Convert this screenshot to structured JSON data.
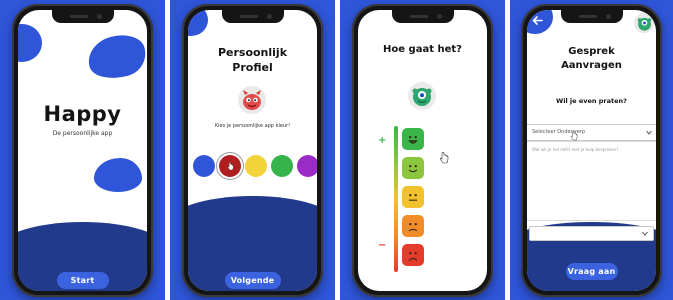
{
  "screens": {
    "welcome": {
      "app_name": "Happy",
      "tagline": "De persoonlijke app",
      "start_button": "Start"
    },
    "profile": {
      "title_line1": "Persoonlijk",
      "title_line2": "Profiel",
      "instruction": "Kies je persoonlijke app kleur!",
      "color_options": [
        "#2f55d9",
        "#b01f1f",
        "#f2d33a",
        "#36b34a",
        "#9b2bc7"
      ],
      "selected_color_index": 1,
      "next_button": "Volgende"
    },
    "mood": {
      "question": "Hoe gaat het?",
      "plus_label": "+",
      "minus_label": "−",
      "scale_colors": [
        "#3ab54a",
        "#8cc63f",
        "#f2c12e",
        "#f28c28",
        "#e53b2c"
      ],
      "avatar_icon": "monster-icon"
    },
    "conversation": {
      "title_line1": "Gesprek",
      "title_line2": "Aanvragen",
      "question": "Wil je even praten?",
      "subject_placeholder": "Selecteer Onderwerp",
      "message_placeholder": "Wat wil je het liefst met je hulp bespreken?",
      "request_button": "Vraag aan",
      "back_icon": "arrow-left-icon",
      "avatar_icon": "monster-icon"
    }
  },
  "colors": {
    "brand_blue": "#2f55d9",
    "navy": "#223a8c",
    "button_blue": "#3b63e0"
  }
}
